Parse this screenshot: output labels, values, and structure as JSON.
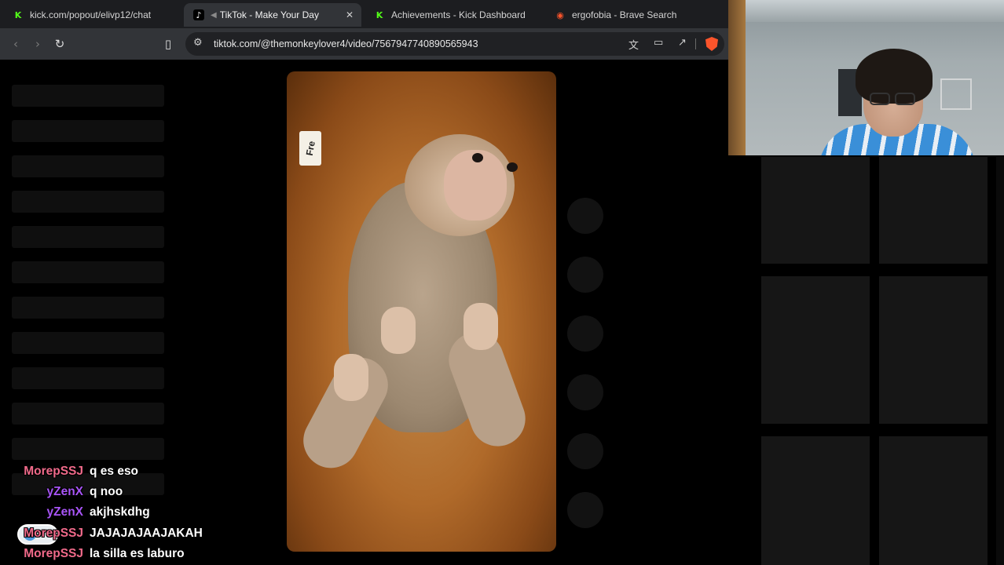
{
  "browser": {
    "tabs": [
      {
        "title": "kick.com/popout/elivp12/chat",
        "favicon": "kick-icon",
        "active": false
      },
      {
        "title": "TikTok - Make Your Day",
        "favicon": "tiktok-icon",
        "active": true,
        "close": "✕"
      },
      {
        "title": "Achievements - Kick Dashboard",
        "favicon": "kick-icon",
        "active": false
      },
      {
        "title": "ergofobia - Brave Search",
        "favicon": "brave-icon",
        "active": false
      }
    ],
    "address": {
      "url": "tiktok.com/@themonkeylover4/video/7567947740890565943"
    },
    "icons": {
      "back": "back-arrow-icon",
      "forward": "forward-arrow-icon",
      "reload": "reload-icon",
      "bookmark": "bookmark-icon",
      "site_settings": "tune-icon",
      "translate": "translate-icon",
      "cast": "cast-icon",
      "share": "share-icon",
      "shields": "brave-shield-icon"
    }
  },
  "video": {
    "subject": "baby monkey on orange blanket",
    "sticker_text": "Fre"
  },
  "chat": {
    "messages": [
      {
        "user": "MorepSSJ",
        "text": "q es eso",
        "color": "#f06a8a"
      },
      {
        "user": "yZenX",
        "text": "q noo",
        "color": "#a855f7"
      },
      {
        "user": "yZenX",
        "text": "akjhskdhg",
        "color": "#a855f7"
      },
      {
        "user": "MorepSSJ",
        "text": "JAJAJAJAAJAKAH",
        "color": "#f06a8a"
      },
      {
        "user": "MorepSSJ",
        "text": "la silla es laburo",
        "color": "#f06a8a"
      }
    ]
  },
  "colors": {
    "kick_green": "#53fc18",
    "brave_orange": "#fb542b",
    "chrome_dark": "#1c1d20",
    "toolbar": "#323438"
  }
}
